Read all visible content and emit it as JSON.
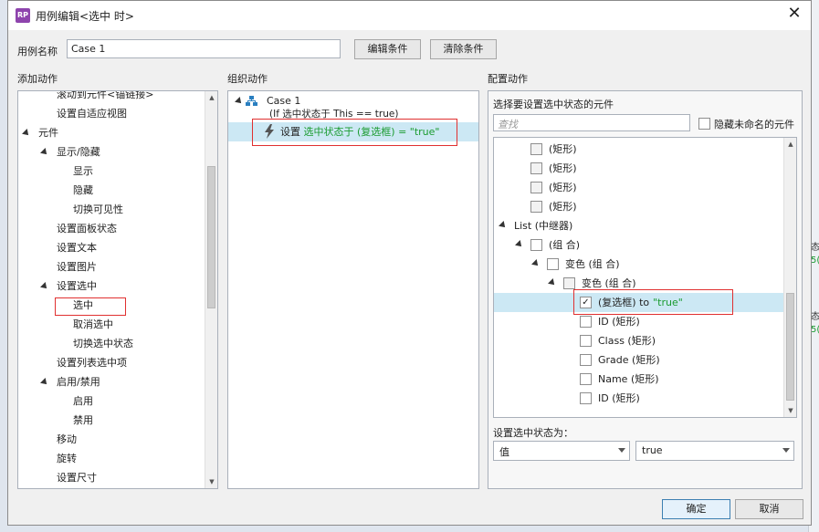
{
  "window": {
    "title": "用例编辑<选中 时>",
    "icon": "axure-rp-icon",
    "icon_text": "RP",
    "close": "✕"
  },
  "case_name": {
    "label": "用例名称",
    "value": "Case 1"
  },
  "buttons": {
    "edit_condition": "编辑条件",
    "clear_condition": "清除条件",
    "ok": "确定",
    "cancel": "取消"
  },
  "add_action": {
    "header": "添加动作",
    "items": [
      {
        "label": "滚动到元件<锚链接>",
        "level": 1
      },
      {
        "label": "设置自适应视图",
        "level": 1
      },
      {
        "label": "元件",
        "level": 0,
        "expanded": true
      },
      {
        "label": "显示/隐藏",
        "level": 1,
        "expanded": true
      },
      {
        "label": "显示",
        "level": 2
      },
      {
        "label": "隐藏",
        "level": 2
      },
      {
        "label": "切换可见性",
        "level": 2
      },
      {
        "label": "设置面板状态",
        "level": 1
      },
      {
        "label": "设置文本",
        "level": 1
      },
      {
        "label": "设置图片",
        "level": 1
      },
      {
        "label": "设置选中",
        "level": 1,
        "expanded": true
      },
      {
        "label": "选中",
        "level": 2,
        "highlighted": true
      },
      {
        "label": "取消选中",
        "level": 2
      },
      {
        "label": "切换选中状态",
        "level": 2
      },
      {
        "label": "设置列表选中项",
        "level": 1
      },
      {
        "label": "启用/禁用",
        "level": 1,
        "expanded": true
      },
      {
        "label": "启用",
        "level": 2
      },
      {
        "label": "禁用",
        "level": 2
      },
      {
        "label": "移动",
        "level": 1
      },
      {
        "label": "旋转",
        "level": 1
      },
      {
        "label": "设置尺寸",
        "level": 1
      }
    ]
  },
  "organize_action": {
    "header": "组织动作",
    "case_label": "Case 1",
    "condition": "(If 选中状态于 This == true)",
    "action_prefix": "设置",
    "action_detail": "选中状态于 (复选框) = \"true\""
  },
  "configure_action": {
    "header": "配置动作",
    "subheader": "选择要设置选中状态的元件",
    "search_placeholder": "查找",
    "hide_unnamed_label": "隐藏未命名的元件",
    "widgets": [
      {
        "label": "(矩形)",
        "level": 1,
        "checked": false,
        "grey": true
      },
      {
        "label": "(矩形)",
        "level": 1,
        "checked": false,
        "grey": true
      },
      {
        "label": "(矩形)",
        "level": 1,
        "checked": false,
        "grey": true
      },
      {
        "label": "(矩形)",
        "level": 1,
        "checked": false,
        "grey": true
      },
      {
        "label": "List (中继器)",
        "level": 0,
        "expanded": true,
        "nocheck": true
      },
      {
        "label": "(组 合)",
        "level": 1,
        "expanded": true,
        "checked": false
      },
      {
        "label": "变色 (组 合)",
        "level": 2,
        "expanded": true,
        "checked": false
      },
      {
        "label": "变色 (组 合)",
        "level": 3,
        "expanded": true,
        "checked": false,
        "grey": true
      },
      {
        "label": "(复选框) to",
        "suffix": "\"true\"",
        "level": 4,
        "checked": true,
        "selected": true
      },
      {
        "label": "ID (矩形)",
        "level": 4,
        "checked": false
      },
      {
        "label": "Class (矩形)",
        "level": 4,
        "checked": false
      },
      {
        "label": "Grade (矩形)",
        "level": 4,
        "checked": false
      },
      {
        "label": "Name (矩形)",
        "level": 4,
        "checked": false
      },
      {
        "label": "ID (矩形)",
        "level": 4,
        "checked": false
      }
    ],
    "set_state_label": "设置选中状态为：",
    "state_type": "值",
    "state_value": "true"
  },
  "background": {
    "snippets": [
      "态",
      "5(",
      "态",
      "5("
    ]
  },
  "colors": {
    "highlight_border": "#e03030",
    "selection": "#cce8f4",
    "green_text": "#1a9b2f"
  }
}
